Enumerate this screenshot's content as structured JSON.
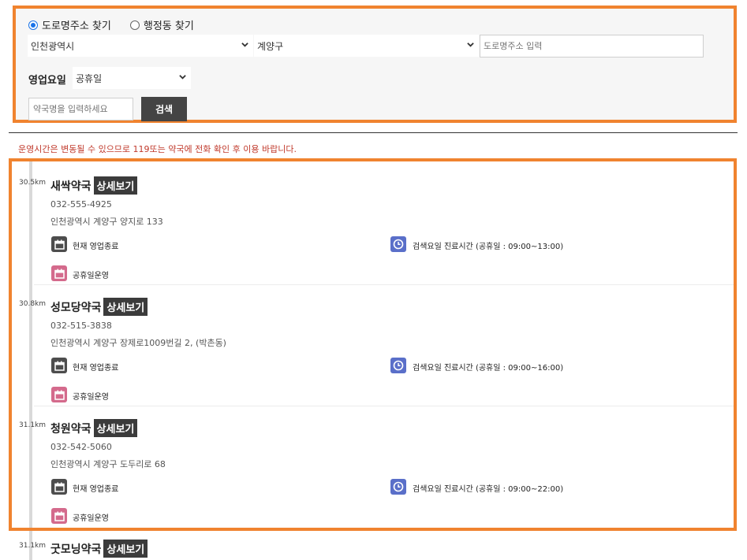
{
  "search": {
    "radio_road": "도로명주소 찾기",
    "radio_dong": "행정동 찾기",
    "city": "인천광역시",
    "district": "계양구",
    "road_placeholder": "도로명주소 입력",
    "day_label": "영업요일",
    "day_value": "공휴일",
    "name_placeholder": "약국명을 입력하세요",
    "search_button": "검색"
  },
  "notice": "운영시간은 변동될 수 있으므로 119또는 약국에 전화 확인 후 이용 바랍니다.",
  "colors": {
    "accent_border": "#f0832f",
    "notice_red": "#c0392b",
    "button_dark": "#444444"
  },
  "pharmacies": [
    {
      "distance": "30.5km",
      "name": "새싹약국",
      "detail": "상세보기",
      "phone": "032-555-4925",
      "address": "인천광역시 계양구 양지로 133",
      "status": "현재 영업종료",
      "hours": "검색요일 진료시간 (공휴일 : 09:00~13:00)",
      "holiday": "공휴일운영"
    },
    {
      "distance": "30.8km",
      "name": "성모당약국",
      "detail": "상세보기",
      "phone": "032-515-3838",
      "address": "인천광역시 계양구 장제로1009번길 2, (박촌동)",
      "status": "현재 영업종료",
      "hours": "검색요일 진료시간 (공휴일 : 09:00~16:00)",
      "holiday": "공휴일운영"
    },
    {
      "distance": "31.1km",
      "name": "청원약국",
      "detail": "상세보기",
      "phone": "032-542-5060",
      "address": "인천광역시 계양구 도두리로 68",
      "status": "현재 영업종료",
      "hours": "검색요일 진료시간 (공휴일 : 09:00~22:00)",
      "holiday": "공휴일운영"
    },
    {
      "distance": "31.1km",
      "name": "굿모닝약국",
      "detail": "상세보기"
    }
  ]
}
